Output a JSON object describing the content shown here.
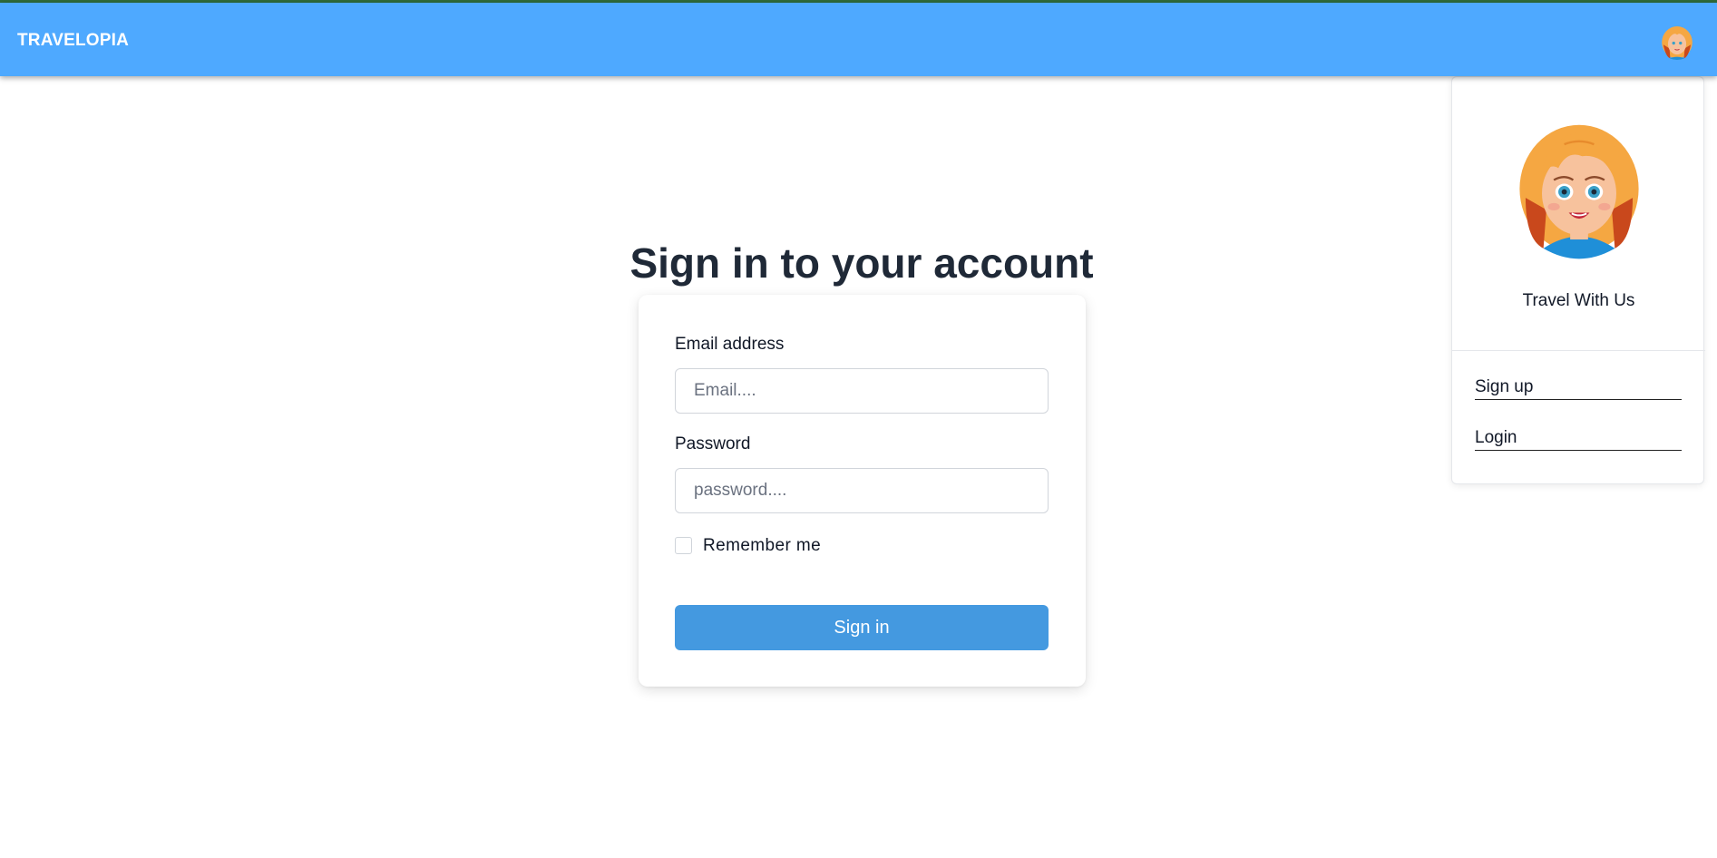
{
  "navbar": {
    "brand": "TRAVELOPIA",
    "avatar_icon": "user-avatar-icon",
    "background": "#4ea9ff"
  },
  "page": {
    "title": "Sign in to your account"
  },
  "form": {
    "email_label": "Email address",
    "email_placeholder": "Email....",
    "email_value": "",
    "password_label": "Password",
    "password_placeholder": "password....",
    "password_value": "",
    "remember_label": "Remember me",
    "remember_checked": false,
    "submit_label": "Sign in",
    "submit_color": "#4499e0"
  },
  "dropdown": {
    "avatar_icon": "user-avatar-icon",
    "tagline": "Travel With Us",
    "items": [
      {
        "label": "Sign up"
      },
      {
        "label": "Login"
      }
    ]
  }
}
